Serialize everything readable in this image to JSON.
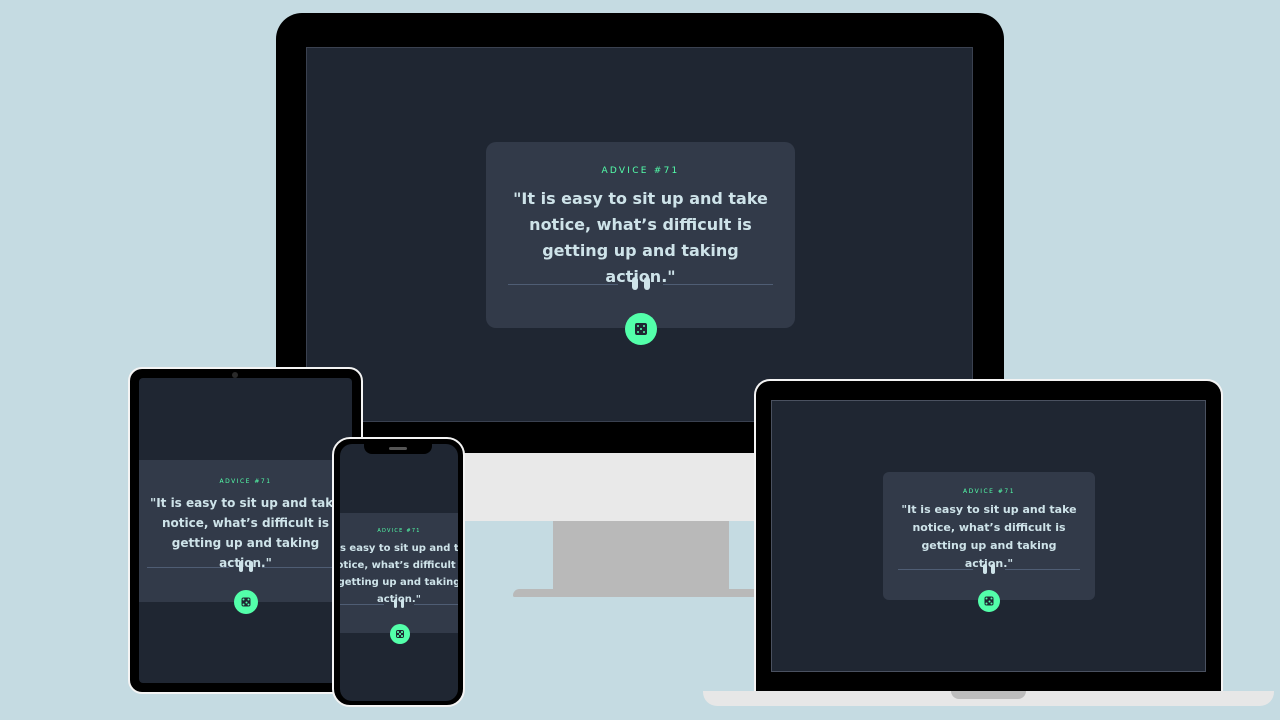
{
  "advice": {
    "label": "ADVICE #71",
    "quote": "\"It is easy to sit up and take notice, what’s difficult is getting up and taking action.\""
  },
  "icons": {
    "divider": "pause-icon",
    "button": "dice-icon"
  },
  "colors": {
    "background": "#c5dbe2",
    "screen": "#1f2632",
    "card": "#323a49",
    "accent": "#53ffaa",
    "quote_text": "#cee3e9",
    "divider_line": "#4f5d74"
  }
}
